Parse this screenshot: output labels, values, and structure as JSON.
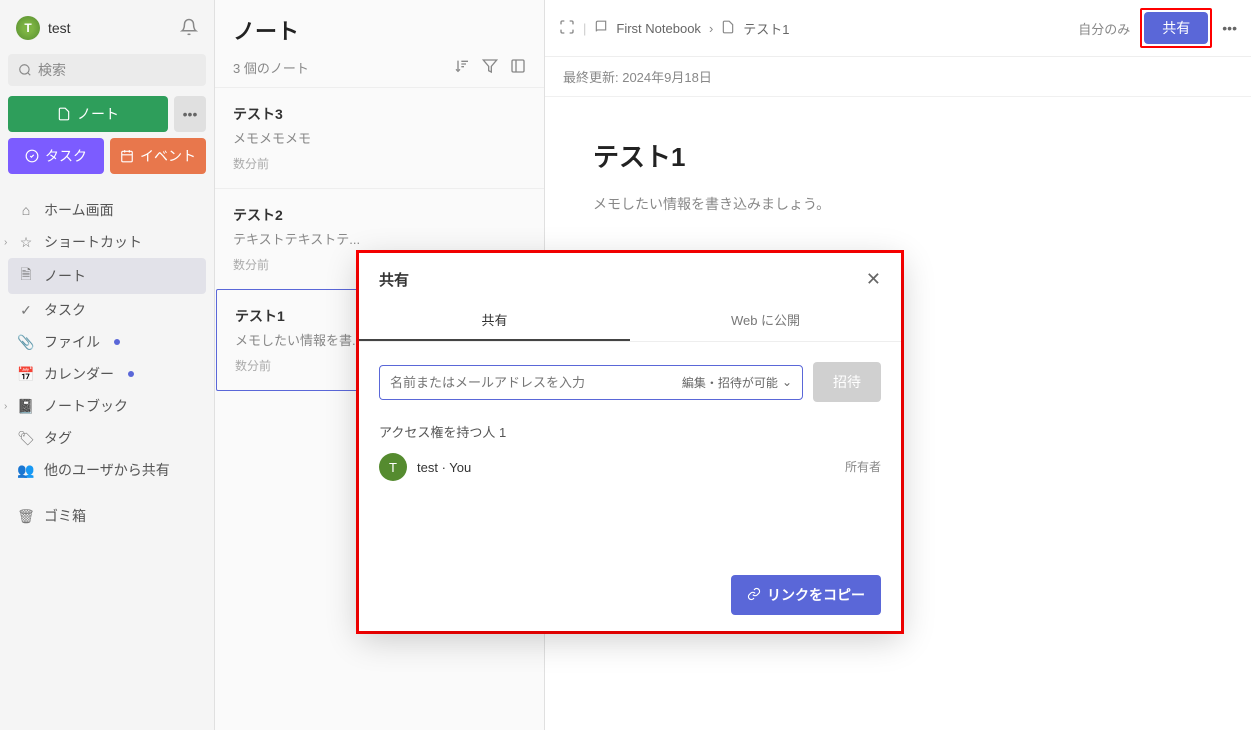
{
  "user": {
    "initial": "T",
    "name": "test"
  },
  "search": {
    "placeholder": "検索"
  },
  "sidebar": {
    "new_note": "ノート",
    "more": "•••",
    "task": "タスク",
    "event": "イベント",
    "nav": [
      {
        "icon": "⌂",
        "label": "ホーム画面"
      },
      {
        "icon": "☆",
        "label": "ショートカット",
        "chev": true
      },
      {
        "icon": "🗎",
        "label": "ノート",
        "active": true
      },
      {
        "icon": "✓",
        "label": "タスク"
      },
      {
        "icon": "📎",
        "label": "ファイル",
        "dot": true
      },
      {
        "icon": "📅",
        "label": "カレンダー",
        "dot": true
      },
      {
        "icon": "📓",
        "label": "ノートブック",
        "chev": true
      },
      {
        "icon": "🏷",
        "label": "タグ"
      },
      {
        "icon": "👥",
        "label": "他のユーザから共有"
      },
      {
        "icon": "🗑",
        "label": "ゴミ箱"
      }
    ]
  },
  "list": {
    "title": "ノート",
    "count": "3 個のノート",
    "items": [
      {
        "title": "テスト3",
        "snippet": "メモメモメモ",
        "time": "数分前"
      },
      {
        "title": "テスト2",
        "snippet": "テキストテキストテ...",
        "time": "数分前"
      },
      {
        "title": "テスト1",
        "snippet": "メモしたい情報を書...",
        "time": "数分前",
        "selected": true
      }
    ]
  },
  "main": {
    "crumb_notebook": "First Notebook",
    "crumb_sep": "›",
    "crumb_note": "テスト1",
    "visibility": "自分のみ",
    "share_btn": "共有",
    "more": "•••",
    "meta": "最終更新: 2024年9月18日",
    "title": "テスト1",
    "body": "メモしたい情報を書き込みましょう。"
  },
  "modal": {
    "title": "共有",
    "tab_share": "共有",
    "tab_web": "Web に公開",
    "input_placeholder": "名前またはメールアドレスを入力",
    "perm": "編集・招待が可能",
    "invite_btn": "招待",
    "access_label": "アクセス権を持つ人",
    "access_count": "1",
    "person_initial": "T",
    "person_name": "test · You",
    "person_role": "所有者",
    "copy_link": "リンクをコピー"
  }
}
